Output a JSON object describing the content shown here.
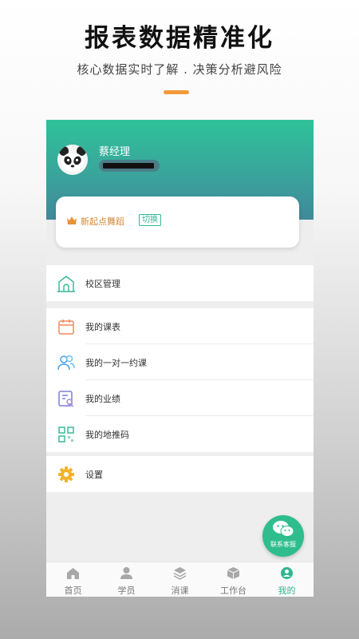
{
  "promo": {
    "title": "报表数据精准化",
    "subtitle": "核心数据实时了解 . 决策分析避风险"
  },
  "profile": {
    "name": "蔡经理"
  },
  "school": {
    "name": "新起点舞蹈",
    "switch_label": "切换"
  },
  "menu": {
    "campus": {
      "label": "校区管理",
      "icon": "building-icon"
    },
    "schedule": {
      "label": "我的课表",
      "icon": "calendar-icon"
    },
    "one_on_one": {
      "label": "我的一对一约课",
      "icon": "users-icon"
    },
    "performance": {
      "label": "我的业绩",
      "icon": "report-icon"
    },
    "qrcode": {
      "label": "我的地推码",
      "icon": "qrcode-icon"
    },
    "settings": {
      "label": "设置",
      "icon": "gear-icon"
    }
  },
  "fab": {
    "label": "联系客服",
    "icon": "wechat-icon"
  },
  "tabs": [
    {
      "label": "首页",
      "icon": "home-icon",
      "active": false
    },
    {
      "label": "学员",
      "icon": "student-icon",
      "active": false
    },
    {
      "label": "消课",
      "icon": "layers-icon",
      "active": false
    },
    {
      "label": "工作台",
      "icon": "cube-icon",
      "active": false
    },
    {
      "label": "我的",
      "icon": "profile-icon",
      "active": true
    }
  ],
  "colors": {
    "accent": "#2fb792",
    "header_top": "#2ec29a",
    "header_bottom": "#40899a",
    "school_name": "#d18a3a",
    "promo_bar": "#f29a3a"
  }
}
